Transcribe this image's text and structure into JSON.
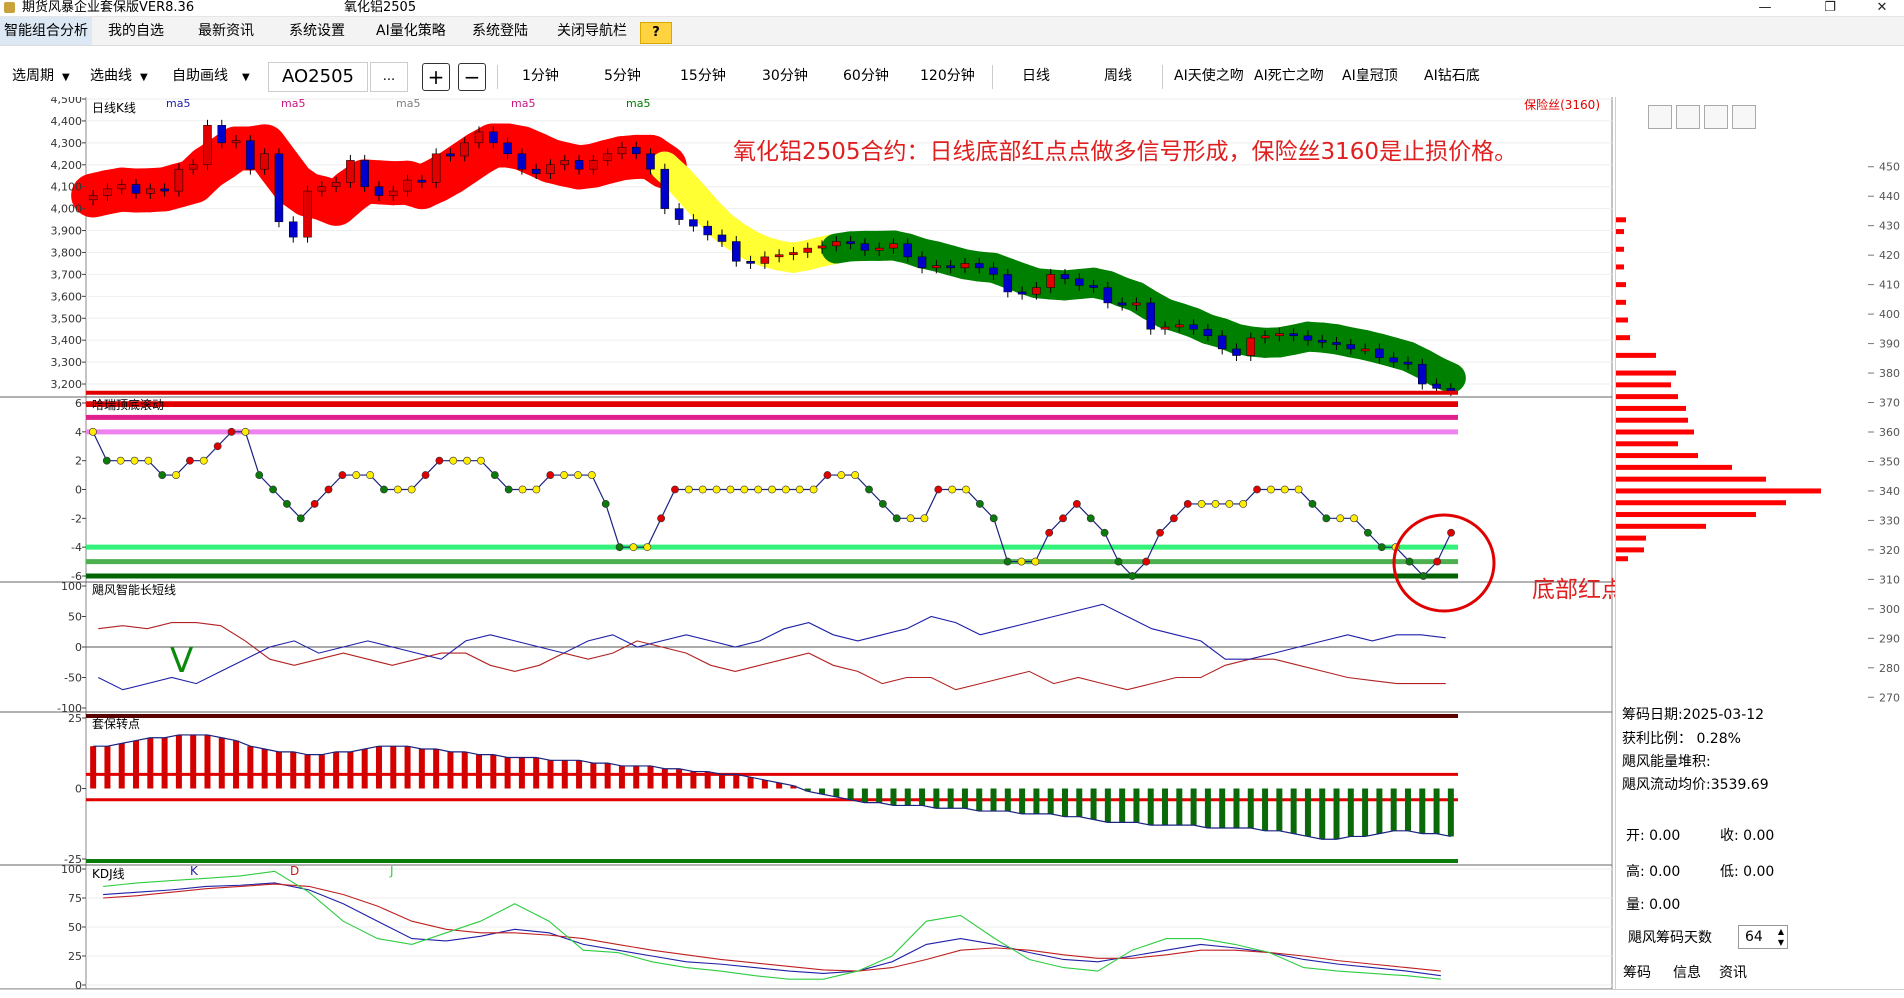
{
  "window": {
    "app_title": "期货风暴企业套保版VER8.36",
    "doc_title": "氧化铝2505"
  },
  "menu": {
    "items": [
      "智能组合分析",
      "我的自选",
      "最新资讯",
      "系统设置",
      "AI量化策略",
      "系统登陆",
      "关闭导航栏"
    ],
    "help": "?"
  },
  "toolbar": {
    "period_select": "选周期",
    "curve_select": "选曲线",
    "draw_select": "自助画线",
    "symbol": "AO2505",
    "more": "...",
    "zoom_in": "+",
    "zoom_out": "−",
    "periods": [
      "1分钟",
      "5分钟",
      "15分钟",
      "30分钟",
      "60分钟",
      "120分钟",
      "日线",
      "周线"
    ],
    "ai_buttons": [
      "AI天使之吻",
      "AI死亡之吻",
      "AI皇冠顶",
      "AI钻石底"
    ]
  },
  "annotations": {
    "main": "氧化铝2505合约：日线底部红点点做多信号形成，保险丝3160是止损价格。",
    "signal": "底部红点点做多信号"
  },
  "right_panel": {
    "chip_date": "筹码日期:2025-03-12",
    "profit_ratio": "获利比例：  0.28%",
    "energy": "飓风能量堆积:",
    "avg_price": "飓风流动均价:3539.69",
    "open": "开: 0.00",
    "close": "收: 0.00",
    "high": "高: 0.00",
    "low": "低: 0.00",
    "volume": "量: 0.00",
    "days_label": "飓风筹码天数",
    "days_value": "64",
    "tabs": [
      "筹码",
      "信息",
      "资讯"
    ]
  },
  "colors": {
    "up": "#e00000",
    "down": "#0000cc",
    "ribbon_red": "#ff0000",
    "ribbon_yellow": "#ffff33",
    "ribbon_green": "#008000",
    "annotation": "#e02020"
  },
  "chart_data": [
    {
      "type": "candlestick",
      "panel": "price",
      "title": "日线K线",
      "legend": [
        "ma5",
        "ma5",
        "ma5",
        "ma5",
        "ma5"
      ],
      "fuse_label": "保险丝(3160)",
      "fuse_value": 3160,
      "ylim": [
        3150,
        4500
      ],
      "yticks": [
        3200,
        3300,
        3400,
        3500,
        3600,
        3700,
        3800,
        3900,
        4000,
        4100,
        4200,
        4300,
        4400,
        4500
      ],
      "ytick_labels": [
        "3,200",
        "3,300",
        "3,400",
        "3,500",
        "3,600",
        "3,700",
        "3,800",
        "3,900",
        "4,000",
        "4,100",
        "4,200",
        "4,300",
        "4,400",
        "4,500"
      ],
      "close": [
        4060,
        4090,
        4110,
        4070,
        4090,
        4080,
        4180,
        4200,
        4380,
        4300,
        4310,
        4180,
        4250,
        3940,
        3870,
        4080,
        4100,
        4120,
        4220,
        4100,
        4060,
        4080,
        4130,
        4120,
        4250,
        4240,
        4300,
        4350,
        4300,
        4250,
        4180,
        4160,
        4200,
        4220,
        4180,
        4220,
        4250,
        4280,
        4250,
        4180,
        4000,
        3950,
        3920,
        3880,
        3850,
        3760,
        3750,
        3780,
        3790,
        3800,
        3820,
        3830,
        3850,
        3840,
        3810,
        3820,
        3840,
        3780,
        3730,
        3740,
        3730,
        3750,
        3730,
        3700,
        3620,
        3610,
        3640,
        3700,
        3680,
        3650,
        3640,
        3570,
        3560,
        3570,
        3450,
        3460,
        3470,
        3450,
        3420,
        3360,
        3330,
        3410,
        3420,
        3430,
        3420,
        3400,
        3390,
        3380,
        3360,
        3360,
        3320,
        3300,
        3290,
        3200,
        3180,
        3170
      ],
      "direction": [
        1,
        1,
        1,
        -1,
        1,
        -1,
        1,
        1,
        1,
        -1,
        1,
        -1,
        1,
        -1,
        -1,
        1,
        1,
        1,
        1,
        -1,
        -1,
        1,
        1,
        -1,
        1,
        -1,
        1,
        1,
        -1,
        -1,
        -1,
        -1,
        1,
        1,
        -1,
        1,
        1,
        1,
        -1,
        -1,
        -1,
        -1,
        -1,
        -1,
        -1,
        -1,
        -1,
        1,
        1,
        1,
        1,
        1,
        1,
        -1,
        -1,
        1,
        1,
        -1,
        -1,
        1,
        -1,
        1,
        -1,
        -1,
        -1,
        -1,
        1,
        1,
        -1,
        -1,
        -1,
        -1,
        -1,
        1,
        -1,
        1,
        1,
        -1,
        -1,
        -1,
        -1,
        1,
        1,
        1,
        -1,
        -1,
        -1,
        -1,
        -1,
        1,
        -1,
        -1,
        -1,
        -1,
        -1,
        -1
      ],
      "ribbon_colors": [
        "red",
        "yellow",
        "green"
      ]
    },
    {
      "type": "line",
      "panel": "hari",
      "title": "哈瑞顶底滚动",
      "ylim": [
        -6,
        6
      ],
      "yticks": [
        -6,
        -4,
        -2,
        0,
        2,
        4,
        6
      ],
      "values": [
        4,
        2,
        2,
        2,
        2,
        1,
        1,
        2,
        2,
        3,
        4,
        4,
        1,
        0,
        -1,
        -2,
        -1,
        0,
        1,
        1,
        1,
        0,
        0,
        0,
        1,
        2,
        2,
        2,
        2,
        1,
        0,
        0,
        0,
        1,
        1,
        1,
        1,
        -1,
        -4,
        -4,
        -4,
        -2,
        0,
        0,
        0,
        0,
        0,
        0,
        0,
        0,
        0,
        0,
        0,
        1,
        1,
        1,
        0,
        -1,
        -2,
        -2,
        -2,
        0,
        0,
        0,
        -1,
        -2,
        -5,
        -5,
        -5,
        -3,
        -2,
        -1,
        -2,
        -3,
        -5,
        -6,
        -5,
        -3,
        -2,
        -1,
        -1,
        -1,
        -1,
        -1,
        0,
        0,
        0,
        0,
        -1,
        -2,
        -2,
        -2,
        -3,
        -4,
        -4,
        -5,
        -6,
        -5,
        -3
      ],
      "levels": [
        5,
        4,
        -4,
        -5,
        -6
      ]
    },
    {
      "type": "line",
      "panel": "hurricane",
      "title": "飓风智能长短线",
      "ylim": [
        -100,
        100
      ],
      "yticks": [
        -100,
        -50,
        0,
        50,
        100
      ],
      "series": [
        {
          "color": "#b22222",
          "values": [
            30,
            35,
            30,
            40,
            40,
            35,
            10,
            -20,
            -30,
            -20,
            -10,
            -20,
            -30,
            -20,
            -10,
            -10,
            -30,
            -40,
            -30,
            -10,
            -20,
            -10,
            10,
            0,
            -10,
            -30,
            -40,
            -30,
            -20,
            -10,
            -30,
            -40,
            -60,
            -50,
            -50,
            -70,
            -60,
            -50,
            -40,
            -60,
            -50,
            -60,
            -70,
            -60,
            -50,
            -50,
            -30,
            -20,
            -20,
            -30,
            -40,
            -50,
            -55,
            -60,
            -60,
            -60
          ]
        },
        {
          "color": "#1f1fa8",
          "values": [
            -50,
            -70,
            -60,
            -50,
            -60,
            -40,
            -20,
            0,
            10,
            -10,
            0,
            10,
            0,
            -10,
            -20,
            10,
            20,
            10,
            0,
            -10,
            10,
            20,
            0,
            10,
            20,
            10,
            0,
            10,
            30,
            40,
            20,
            10,
            20,
            30,
            50,
            40,
            20,
            30,
            40,
            50,
            60,
            70,
            50,
            30,
            20,
            10,
            -20,
            -20,
            -10,
            0,
            10,
            20,
            10,
            20,
            20,
            15
          ]
        }
      ],
      "mark": "V"
    },
    {
      "type": "bar",
      "panel": "hedge",
      "title": "套保转点",
      "ylim": [
        -25,
        25
      ],
      "yticks": [
        -25,
        0,
        25
      ],
      "values": [
        15,
        15,
        16,
        17,
        18,
        18,
        19,
        19,
        19,
        18,
        17,
        15,
        14,
        13,
        13,
        12,
        12,
        13,
        13,
        14,
        15,
        15,
        15,
        14,
        14,
        13,
        13,
        12,
        12,
        11,
        11,
        11,
        10,
        10,
        10,
        9,
        9,
        8,
        8,
        8,
        7,
        7,
        6,
        6,
        5,
        5,
        4,
        3,
        2,
        1,
        -1,
        -2,
        -3,
        -4,
        -5,
        -5,
        -6,
        -6,
        -6,
        -7,
        -7,
        -7,
        -8,
        -8,
        -8,
        -9,
        -9,
        -9,
        -10,
        -10,
        -11,
        -12,
        -12,
        -12,
        -13,
        -13,
        -13,
        -13,
        -14,
        -14,
        -14,
        -14,
        -15,
        -15,
        -16,
        -17,
        -18,
        -18,
        -17,
        -17,
        -16,
        -15,
        -15,
        -16,
        -16,
        -17
      ]
    },
    {
      "type": "line",
      "panel": "kdj",
      "title": "KDJ线",
      "legend": [
        "K",
        "D",
        "J"
      ],
      "ylim": [
        0,
        100
      ],
      "yticks": [
        0,
        25,
        50,
        75,
        100
      ],
      "series": [
        {
          "name": "K",
          "color": "#1f1fa8",
          "values": [
            78,
            80,
            82,
            85,
            86,
            88,
            82,
            70,
            55,
            40,
            38,
            42,
            48,
            45,
            35,
            30,
            25,
            20,
            18,
            15,
            12,
            10,
            12,
            20,
            35,
            40,
            35,
            28,
            22,
            20,
            25,
            30,
            35,
            32,
            28,
            22,
            18,
            15,
            12,
            8
          ]
        },
        {
          "name": "D",
          "color": "#c02020",
          "values": [
            75,
            77,
            80,
            83,
            85,
            87,
            85,
            78,
            68,
            55,
            48,
            45,
            45,
            43,
            40,
            35,
            30,
            26,
            22,
            19,
            16,
            13,
            12,
            15,
            22,
            30,
            32,
            30,
            26,
            23,
            23,
            26,
            30,
            30,
            28,
            25,
            21,
            18,
            15,
            12
          ]
        },
        {
          "name": "J",
          "color": "#2ecc40",
          "values": [
            85,
            88,
            90,
            92,
            94,
            98,
            80,
            55,
            40,
            35,
            45,
            55,
            70,
            55,
            30,
            28,
            20,
            15,
            12,
            8,
            5,
            5,
            12,
            25,
            55,
            60,
            40,
            22,
            15,
            12,
            30,
            40,
            40,
            35,
            28,
            15,
            12,
            10,
            8,
            5
          ]
        }
      ]
    },
    {
      "type": "bar",
      "panel": "chips",
      "title": "筹码",
      "ylim": [
        265,
        455
      ],
      "yticks": [
        270,
        280,
        290,
        300,
        310,
        320,
        330,
        340,
        350,
        360,
        370,
        380,
        390,
        400,
        410,
        420,
        430,
        440,
        450
      ],
      "levels": [
        432,
        428,
        422,
        416,
        410,
        404,
        398,
        392,
        386,
        380,
        376,
        372,
        368,
        364,
        360,
        356,
        352,
        348,
        344,
        340,
        336,
        332,
        328,
        324,
        320,
        317
      ],
      "values": [
        10,
        8,
        8,
        8,
        10,
        10,
        12,
        14,
        40,
        60,
        55,
        62,
        70,
        72,
        78,
        62,
        82,
        116,
        150,
        205,
        170,
        140,
        90,
        30,
        28,
        12
      ]
    }
  ]
}
